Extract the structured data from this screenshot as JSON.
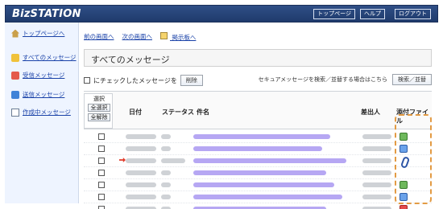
{
  "header": {
    "logo": "BizSTATION",
    "links": [
      "トップページ",
      "ヘルプ",
      "ログアウト"
    ]
  },
  "sidebar": {
    "items": [
      {
        "label": "トップページへ",
        "icon": "home-icon"
      },
      {
        "label": "すべてのメッセージ",
        "icon": "messages-icon"
      },
      {
        "label": "受信メッセージ",
        "icon": "inbox-icon"
      },
      {
        "label": "送信メッセージ",
        "icon": "sent-icon"
      },
      {
        "label": "作成中メッセージ",
        "icon": "draft-icon"
      }
    ]
  },
  "nav": {
    "prev": "前の画面へ",
    "next": "次の画面へ",
    "board": "掲示板へ"
  },
  "main": {
    "title": "すべてのメッセージ",
    "actions": {
      "checked_label": "にチェックしたメッセージを",
      "delete_button": "削除",
      "search_hint": "セキュアメッセージを検索／並替する場合はこちら",
      "search_button": "検索／並替"
    },
    "table": {
      "select_label": "選択",
      "select_all": "全選択",
      "deselect_all": "全解除",
      "columns": {
        "date": "日付",
        "status": "ステータス",
        "subject": "件名",
        "sender": "差出人",
        "attachment": "添付ファイル"
      }
    }
  },
  "rows": [
    {
      "attachment_icon": "excel-icon"
    },
    {
      "attachment_icon": "document-icon"
    },
    {
      "attachment_icon": "paperclip-icon",
      "unread": true
    },
    {
      "attachment_icon": ""
    },
    {
      "attachment_icon": "excel-icon"
    },
    {
      "attachment_icon": "document-icon"
    },
    {
      "attachment_icon": "pdf-icon"
    }
  ],
  "colors": {
    "header_bg": "#23467e",
    "link": "#1a42a8",
    "highlight": "#e39b44"
  }
}
